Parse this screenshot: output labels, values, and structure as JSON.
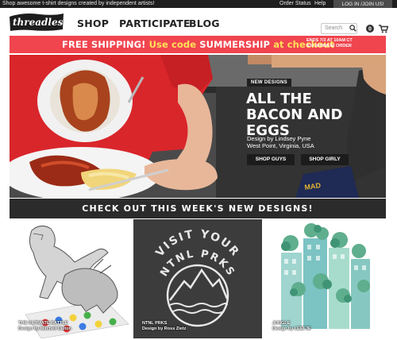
{
  "topbar": {
    "tagline": "Shop awesome t-shirt designs created by independent artists!",
    "order_status": "Order Status",
    "help": "Help",
    "login": "LOG IN /JOIN US!"
  },
  "header": {
    "logo_text": "threadless",
    "nav": [
      "SHOP",
      "PARTICIPATE",
      "BLOG"
    ],
    "search_placeholder": "Search",
    "cart_count": "0"
  },
  "promo": {
    "lead": "FREE SHIPPING!",
    "use_code": "Use code",
    "code": "SUMMERSHIP",
    "at_checkout": "at checkout",
    "fine_line1": "ENDS 7/3 AT 10AM CT",
    "fine_line2": "$35 MINIMUM ORDER"
  },
  "hero": {
    "badge": "NEW DESIGNS",
    "title_line1": "ALL THE",
    "title_line2": "BACON AND",
    "title_line3": "EGGS",
    "designer": "Design by Lindsey Pyne",
    "location": "West Point, Virginia, USA",
    "shop_guys": "SHOP GUYS",
    "shop_girly": "SHOP GIRLY"
  },
  "new_designs_heading": "CHECK OUT THIS WEEK'S NEW DESIGNS!",
  "tiles": [
    {
      "title": "THE ULTIMATE BATTLE",
      "designer": "Design by Mitchell Dalton"
    },
    {
      "title": "NTNL PRKS",
      "designer": "Design by Ross Zietz",
      "art_line1": "VISIT YOUR",
      "art_line2": "NTNL PRKS"
    },
    {
      "title": "JUNGLE",
      "designer": "Design by LEEFJE"
    }
  ],
  "colors": {
    "promo_bg": "#f0454f",
    "promo_highlight": "#ffe15a",
    "dark": "#2b2b2b"
  }
}
